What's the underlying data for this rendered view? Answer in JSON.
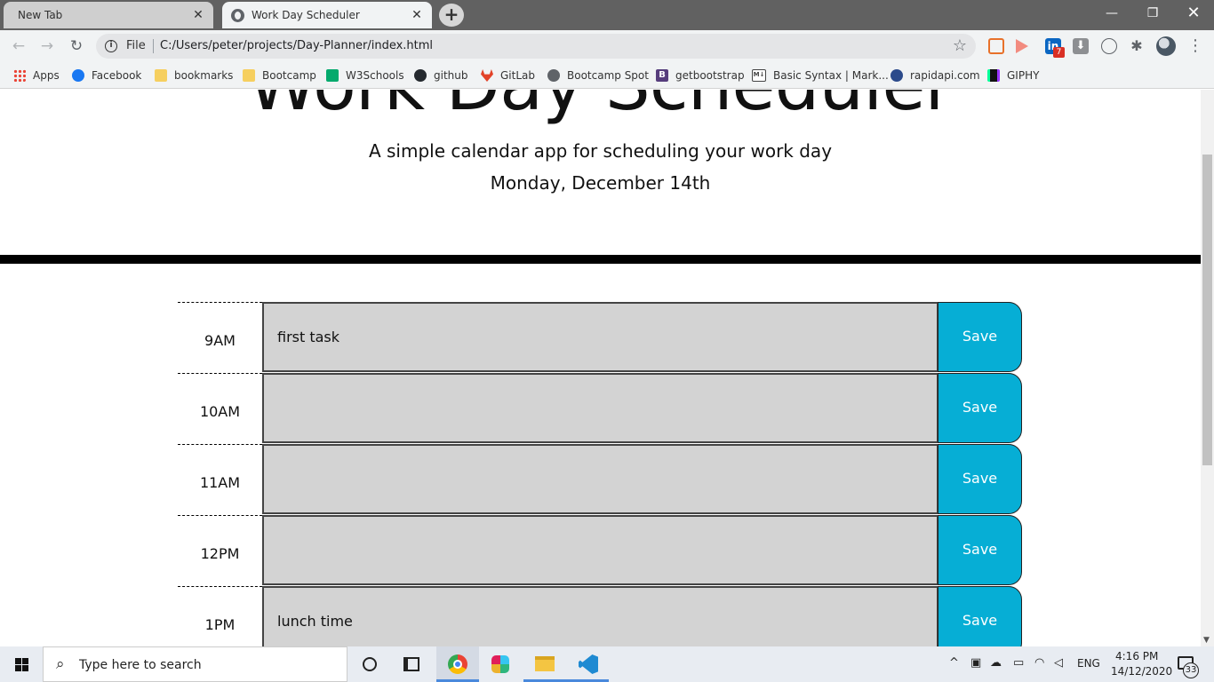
{
  "browser": {
    "tabs": [
      {
        "title": "New Tab",
        "close": "✕"
      },
      {
        "title": "Work Day Scheduler",
        "close": "✕"
      }
    ],
    "new_tab_symbol": "+",
    "window_controls": {
      "minimize": "—",
      "restore": "❐",
      "close": "✕"
    },
    "nav": {
      "back": "←",
      "forward": "→",
      "reload": "↻"
    },
    "omnibox": {
      "scheme_label": "File",
      "url": "C:/Users/peter/projects/Day-Planner/index.html",
      "star": "☆",
      "info": "i"
    },
    "extensions": {
      "linkedin_label": "in",
      "linkedin_badge": "7",
      "download": "⬇",
      "puzzle": "✱",
      "menu": "⋮"
    },
    "bookmarks": [
      {
        "label": "Apps",
        "icon": "apps-grid-icon"
      },
      {
        "label": "Facebook",
        "icon": "facebook-icon"
      },
      {
        "label": "bookmarks",
        "icon": "folder-icon"
      },
      {
        "label": "Bootcamp",
        "icon": "folder-icon"
      },
      {
        "label": "W3Schools",
        "icon": "w3schools-icon"
      },
      {
        "label": "github",
        "icon": "github-icon"
      },
      {
        "label": "GitLab",
        "icon": "gitlab-icon"
      },
      {
        "label": "Bootcamp Spot",
        "icon": "globe-icon"
      },
      {
        "label": "getbootstrap",
        "icon": "bootstrap-icon"
      },
      {
        "label": "Basic Syntax | Mark...",
        "icon": "markdown-icon"
      },
      {
        "label": "rapidapi.com",
        "icon": "rapidapi-icon"
      },
      {
        "label": "GIPHY",
        "icon": "giphy-icon"
      }
    ],
    "bootstrap_letter": "B",
    "markdown_letters": "M↓"
  },
  "page": {
    "title": "Work Day Scheduler",
    "lead": "A simple calendar app for scheduling your work day",
    "current_day": "Monday, December 14th",
    "rows": [
      {
        "hour": "9AM",
        "text": "first task",
        "save": "Save"
      },
      {
        "hour": "10AM",
        "text": "",
        "save": "Save"
      },
      {
        "hour": "11AM",
        "text": "",
        "save": "Save"
      },
      {
        "hour": "12PM",
        "text": "",
        "save": "Save"
      },
      {
        "hour": "1PM",
        "text": "lunch time",
        "save": "Save"
      }
    ],
    "colors": {
      "save_button": "#06aed5",
      "textarea_bg": "#d3d3d3"
    }
  },
  "taskbar": {
    "search_placeholder": "Type here to search",
    "search_icon": "⌕",
    "apps": [
      "chrome-icon",
      "slack-icon",
      "file-explorer-icon",
      "vscode-icon"
    ],
    "tray": {
      "chevron": "^",
      "language": "ENG",
      "time": "4:16 PM",
      "date": "14/12/2020",
      "notifications": "33"
    }
  }
}
